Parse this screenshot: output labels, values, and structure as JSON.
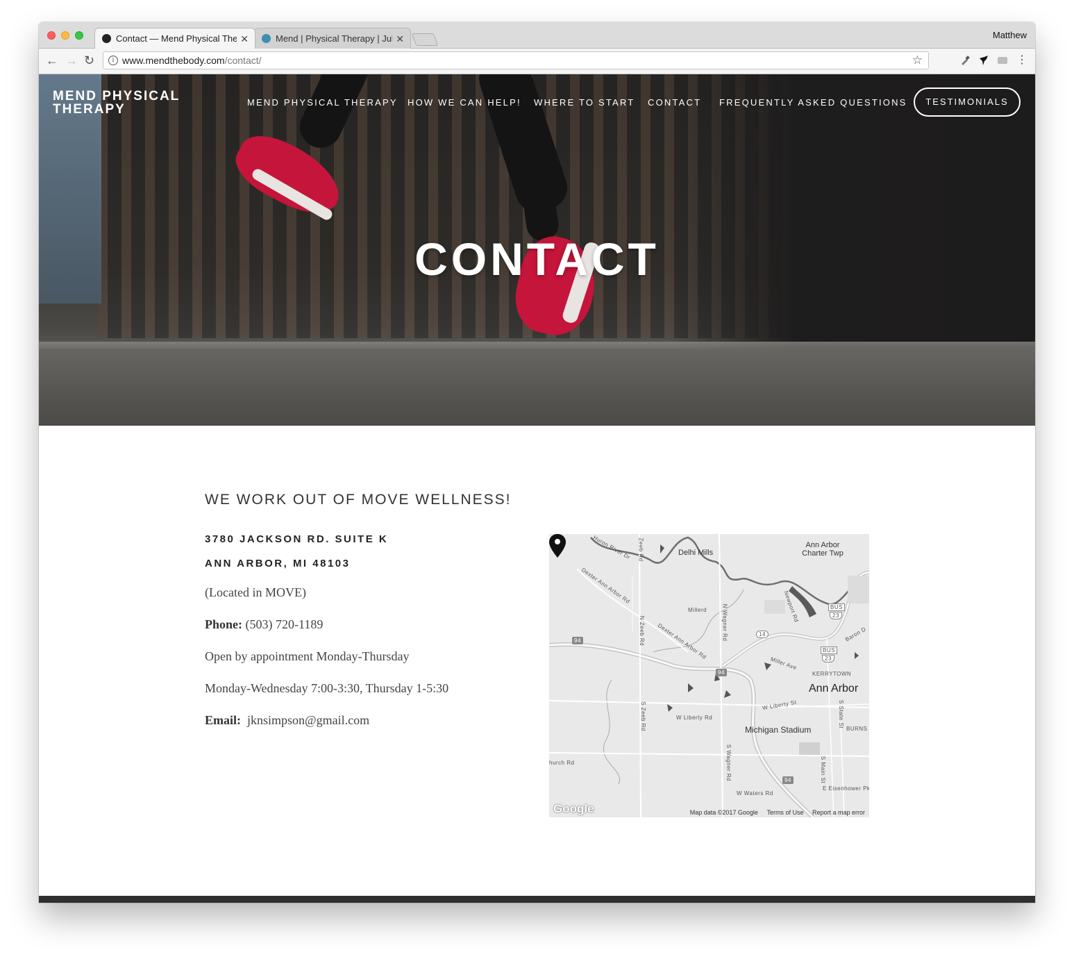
{
  "browser": {
    "tabs": [
      {
        "title": "Contact — Mend Physical Therapy"
      },
      {
        "title": "Mend | Physical Therapy | Julie"
      }
    ],
    "profile_name": "Matthew",
    "url_host": "www.mendthebody.com",
    "url_path": "/contact/",
    "icons": {
      "back": "←",
      "forward": "→",
      "reload": "↻",
      "info": "i",
      "star": "☆",
      "menu": "⋮",
      "close": "✕"
    }
  },
  "site": {
    "brand": "MEND PHYSICAL THERAPY",
    "nav": [
      {
        "label": "MEND PHYSICAL THERAPY"
      },
      {
        "label": "HOW WE CAN HELP!"
      },
      {
        "label": "WHERE TO START"
      },
      {
        "label": "CONTACT"
      },
      {
        "label": "FREQUENTLY ASKED QUESTIONS"
      }
    ],
    "cta": "TESTIMONIALS",
    "hero_title": "CONTACT"
  },
  "content": {
    "heading": "WE WORK OUT OF MOVE WELLNESS!",
    "address_line1": "3780 JACKSON RD. SUITE K",
    "address_line2": "ANN ARBOR, MI 48103",
    "located": "(Located in MOVE)",
    "phone_label": "Phone:",
    "phone": "(503) 720-1189",
    "hours_note": "Open by appointment Monday-Thursday",
    "hours": "Monday-Wednesday 7:00-3:30, Thursday 1-5:30",
    "email_label": "Email:",
    "email": "jknsimpson@gmail.com"
  },
  "map": {
    "labels": {
      "delhi_mills": "Delhi Mills",
      "charter_twp": "Ann Arbor Charter Twp",
      "ann_arbor": "Ann Arbor",
      "kerrytown": "KERRYTOWN",
      "michigan_stadium": "Michigan Stadium",
      "burns": "BURNS I",
      "w_liberty": "W Liberty Rd",
      "w_liberty_st": "W Liberty St",
      "miller_ave": "Miller Ave",
      "s_zeeb": "S Zeeb Rd",
      "n_zeeb": "N Zeeb Rd",
      "zeeb_top": "Zeeb Rd",
      "n_wagner": "N Wagner Rd",
      "s_wagner": "S Wagner Rd",
      "w_waters": "W Waters Rd",
      "church_rd": "hurch Rd",
      "dexter_ann_arbor": "Dexter Ann Arbor Rd",
      "huron_river": "Huron River Dr",
      "millerdal": "Millerd",
      "s_state": "S State St",
      "s_main": "S Main St",
      "e_eisenhower": "E Eisenhower Pk",
      "newport": "Newport Rd",
      "baron": "Baron D"
    },
    "shields": {
      "i94_a": "94",
      "i94_b": "94",
      "i94_c": "94",
      "m14": "14",
      "bus23_a": "23",
      "bus23_b": "23",
      "bus_a": "BUS",
      "bus_b": "BUS"
    },
    "attribution": "Map data ©2017 Google",
    "terms": "Terms of Use",
    "report": "Report a map error",
    "logo": "Google"
  },
  "colors": {
    "hero_text": "#ffffff",
    "footer_bar": "#2f2f2f",
    "shoe": "#c5153a"
  }
}
